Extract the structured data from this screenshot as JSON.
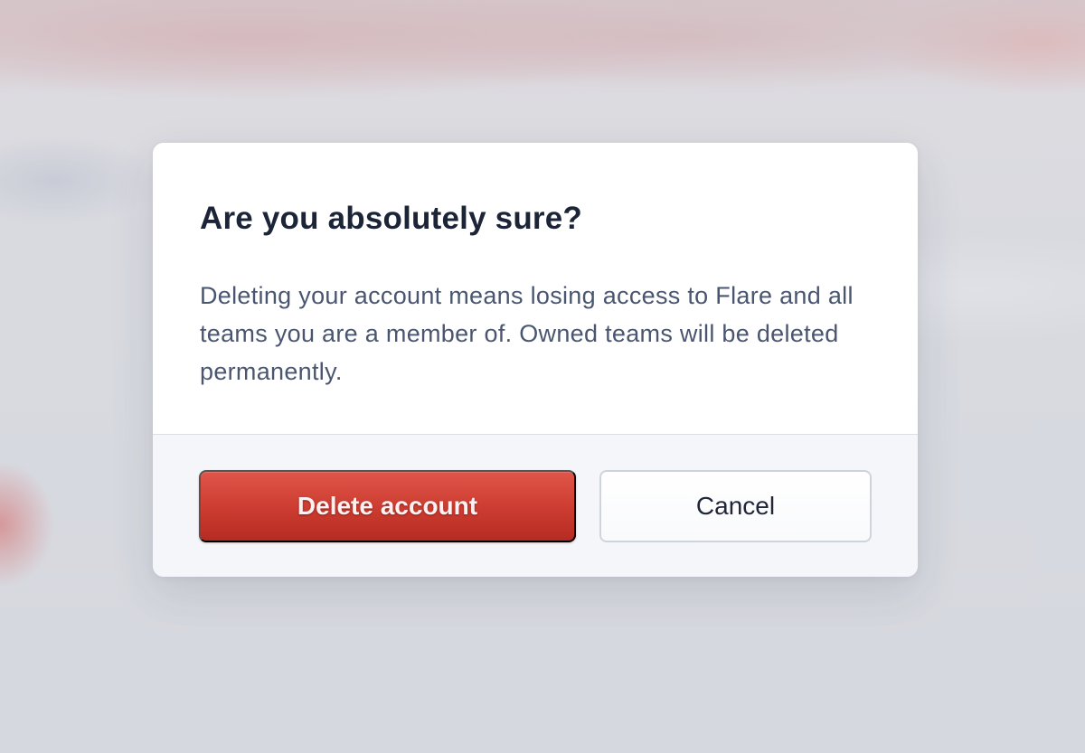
{
  "dialog": {
    "title": "Are you absolutely sure?",
    "message": "Deleting your account means losing access to Flare and all teams you are a member of. Owned teams will be deleted permanently.",
    "confirm_label": "Delete account",
    "cancel_label": "Cancel"
  },
  "colors": {
    "danger": "#cc3b30",
    "title_text": "#1c2438",
    "body_text": "#4a5670"
  }
}
